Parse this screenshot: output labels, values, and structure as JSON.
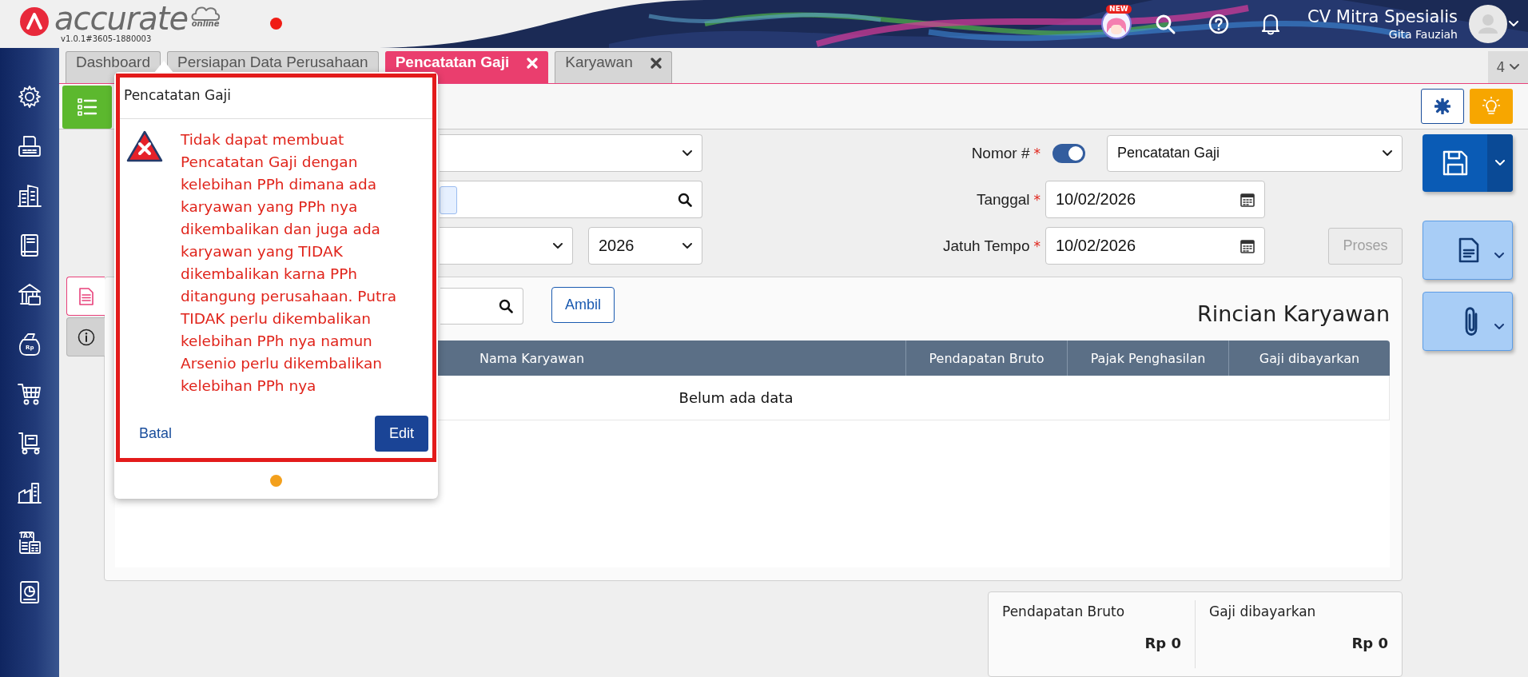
{
  "header": {
    "logo": "accurate",
    "logo_suffix": "online",
    "version": "v1.0.1#3605-1880003",
    "new_badge": "NEW",
    "company": "CV Mitra Spesialis",
    "user": "Gita Fauziah"
  },
  "sidebar": {
    "items": [
      {
        "kind": "gear"
      },
      {
        "kind": "fax"
      },
      {
        "kind": "building"
      },
      {
        "kind": "book"
      },
      {
        "kind": "bank"
      },
      {
        "kind": "bag",
        "badge": "Rp"
      },
      {
        "kind": "cart"
      },
      {
        "kind": "trolley"
      },
      {
        "kind": "factory"
      },
      {
        "kind": "tax",
        "badge": "TAX"
      },
      {
        "kind": "report"
      }
    ]
  },
  "tabs": [
    {
      "label": "Dashboard",
      "selected": false,
      "closable": false
    },
    {
      "label": "Persiapan Data Perusahaan",
      "selected": false,
      "closable": false
    },
    {
      "label": "Pencatatan Gaji",
      "selected": true,
      "closable": true
    },
    {
      "label": "Karyawan",
      "selected": false,
      "closable": true
    }
  ],
  "tab_overflow": "4",
  "form": {
    "year": "2026",
    "number": {
      "label": "Nomor #",
      "mark": "*",
      "auto": true,
      "value": "Pencatatan Gaji"
    },
    "date": {
      "label": "Tanggal",
      "mark": "*",
      "value": "10/02/2026"
    },
    "due": {
      "label": "Jatuh Tempo",
      "mark": "*",
      "value": "10/02/2026"
    },
    "process_button": {
      "label": "Proses",
      "disabled": true
    }
  },
  "side_tabs": [
    {
      "kind": "document",
      "selected": true
    },
    {
      "kind": "info",
      "selected": false
    }
  ],
  "detail": {
    "title": "Rincian Karyawan",
    "fetch_button": "Ambil",
    "columns": [
      "Nama Karyawan",
      "Pendapatan Bruto",
      "Pajak Penghasilan",
      "Gaji dibayarkan"
    ],
    "empty_text": "Belum ada data"
  },
  "summary": [
    {
      "label": "Pendapatan Bruto",
      "value": "Rp 0"
    },
    {
      "label": "Gaji dibayarkan",
      "value": "Rp 0"
    }
  ],
  "dialog": {
    "title": "Pencatatan Gaji",
    "message": "Tidak dapat membuat Pencatatan Gaji dengan kelebihan PPh dimana ada karyawan yang PPh nya dikembalikan dan juga ada karyawan yang TIDAK dikembalikan karna PPh ditangung perusahaan. Putra TIDAK perlu dikembalikan kelebihan PPh nya namun Arsenio perlu dikembalikan kelebihan PPh nya",
    "cancel": "Batal",
    "confirm": "Edit"
  }
}
